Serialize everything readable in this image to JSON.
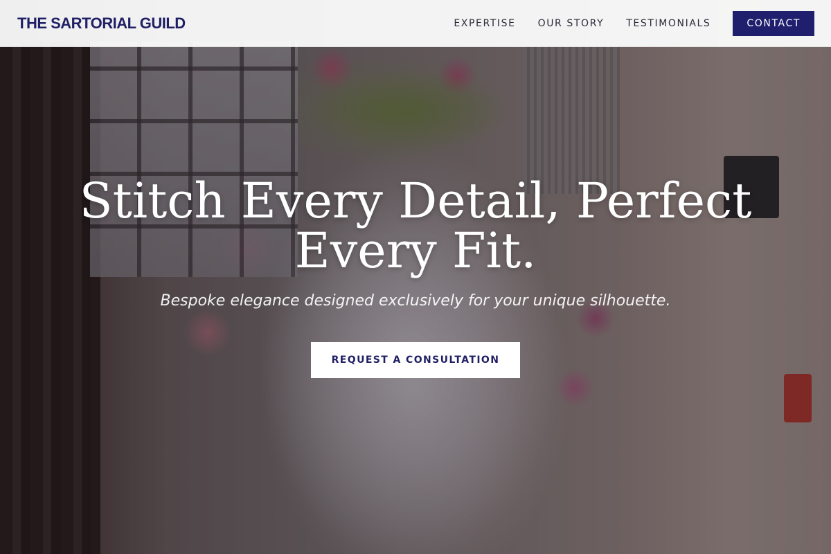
{
  "brand": "THE SARTORIAL GUILD",
  "nav": {
    "links": [
      "EXPERTISE",
      "OUR STORY",
      "TESTIMONIALS"
    ],
    "cta": "CONTACT"
  },
  "hero": {
    "headline_line1": "Stitch Every Detail, Perfect",
    "headline_line2": "Every Fit.",
    "subheadline": "Bespoke elegance designed exclusively for your unique silhouette.",
    "cta": "REQUEST A CONSULTATION"
  },
  "colors": {
    "brand_navy": "#1f1f66",
    "nav_background": "#ffffff",
    "text_light": "#ffffff"
  }
}
